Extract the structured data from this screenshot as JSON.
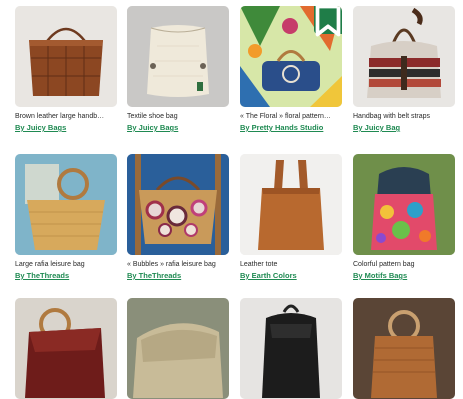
{
  "colors": {
    "accent": "#1f8a52",
    "bookmark_bg": "#1f7d48"
  },
  "products": [
    {
      "title": "Brown leather large handb…",
      "seller": "By Juicy Bags",
      "bookmarked": false
    },
    {
      "title": "Textile shoe bag",
      "seller": "By Juicy Bags",
      "bookmarked": false
    },
    {
      "title": "« The Floral » floral pattern…",
      "seller": "By Pretty Hands Studio",
      "bookmarked": true
    },
    {
      "title": "Handbag with belt straps",
      "seller": "By Juicy Bag",
      "bookmarked": false
    },
    {
      "title": "Large rafia leisure bag",
      "seller": "By TheThreads",
      "bookmarked": false
    },
    {
      "title": "« Bubbles » rafia leisure bag",
      "seller": "By TheThreads",
      "bookmarked": false
    },
    {
      "title": "Leather tote",
      "seller": "By Earth Colors",
      "bookmarked": false
    },
    {
      "title": "Colorful pattern bag",
      "seller": "By Motifs Bags",
      "bookmarked": false
    },
    {
      "title": "",
      "seller": "",
      "bookmarked": false
    },
    {
      "title": "",
      "seller": "",
      "bookmarked": false
    },
    {
      "title": "",
      "seller": "",
      "bookmarked": false
    },
    {
      "title": "",
      "seller": "",
      "bookmarked": false
    }
  ],
  "icons": {
    "bookmark": "bookmark-icon"
  }
}
